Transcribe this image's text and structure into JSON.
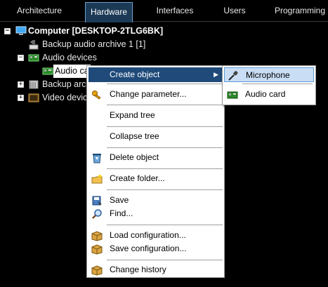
{
  "tabs": [
    {
      "label": "Architecture"
    },
    {
      "label": "Hardware"
    },
    {
      "label": "Interfaces"
    },
    {
      "label": "Users"
    },
    {
      "label": "Programming"
    }
  ],
  "active_tab": "Hardware",
  "tree": {
    "computer": "Computer [DESKTOP-2TLG6BK]",
    "backup_audio": "Backup audio archive 1 [1]",
    "audio_devices": "Audio devices",
    "audio_card": "Audio ca",
    "audio_card_tail": "[ ]",
    "backup_arch": "Backup arch",
    "video_devices": "Video device"
  },
  "context_menu": {
    "create_object": "Create object",
    "change_parameter": "Change parameter...",
    "expand_tree": "Expand tree",
    "collapse_tree": "Collapse tree",
    "delete_object": "Delete object",
    "create_folder": "Create folder...",
    "save": "Save",
    "find": "Find...",
    "load_configuration": "Load configuration...",
    "save_configuration": "Save configuration...",
    "change_history": "Change history"
  },
  "submenu": {
    "microphone": "Microphone",
    "audio_card": "Audio card"
  },
  "colors": {
    "background": "#000000",
    "active_tab": "#1c3a56",
    "menu_hover": "#1f4a7a",
    "submenu_highlight": "#c9def5"
  }
}
